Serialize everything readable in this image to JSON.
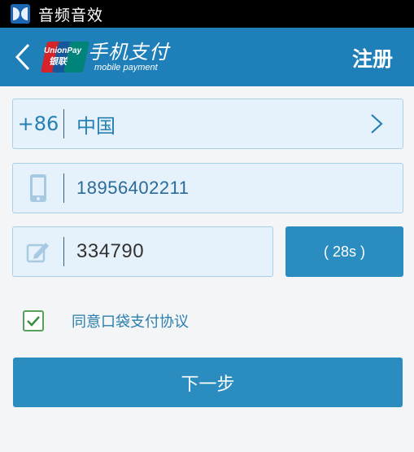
{
  "statusbar": {
    "app_title": "音频音效",
    "icon": "dolby-icon"
  },
  "header": {
    "back_icon": "chevron-left-icon",
    "logo_text_en": "UnionPay",
    "logo_text_cn": "银联",
    "brand_cn": "手机支付",
    "brand_en": "mobile payment",
    "title": "注册"
  },
  "form": {
    "country_code": "+86",
    "country_name": "中国",
    "country_chevron_icon": "chevron-right-icon",
    "phone_icon": "phone-icon",
    "phone_number": "18956402211",
    "code_icon": "pencil-icon",
    "verification_code": "334790",
    "countdown_label": "( 28s )"
  },
  "agreement": {
    "checked": true,
    "label": "同意口袋支付协议"
  },
  "actions": {
    "next_label": "下一步"
  },
  "colors": {
    "header": "#1f7fb9",
    "button": "#2a8cbf",
    "field_bg": "#e5f1fb",
    "check": "#5aa05c"
  }
}
